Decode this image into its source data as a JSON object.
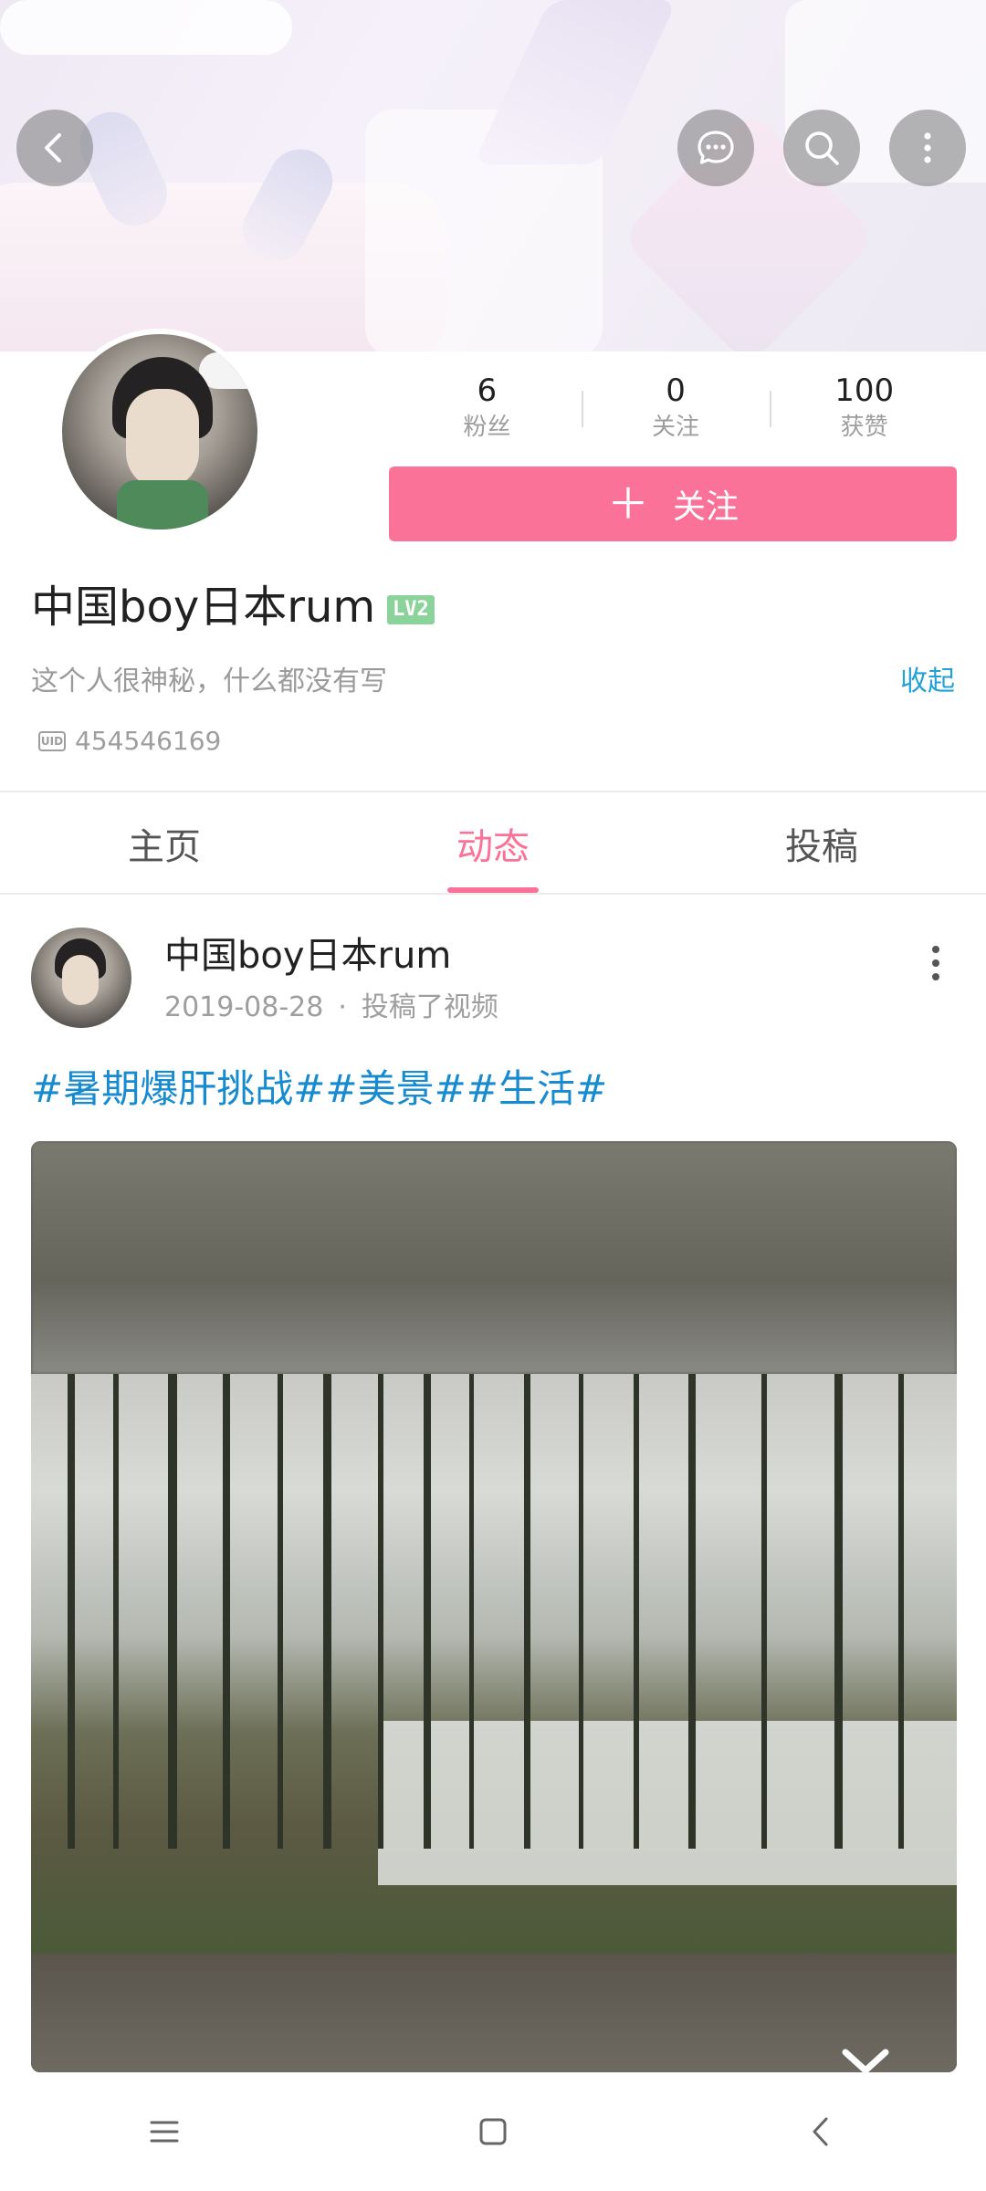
{
  "header": {
    "back_icon": "back-chevron-icon",
    "message_icon": "message-bubble-icon",
    "search_icon": "search-icon",
    "more_icon": "more-vertical-icon"
  },
  "profile": {
    "stats": [
      {
        "value": "6",
        "label": "粉丝"
      },
      {
        "value": "0",
        "label": "关注"
      },
      {
        "value": "100",
        "label": "获赞"
      }
    ],
    "follow_button": {
      "plus": "＋",
      "label": "关注"
    },
    "username": "中国boy日本rum",
    "level": "LV2",
    "bio": "这个人很神秘，什么都没有写",
    "collapse_label": "收起",
    "uid_icon_text": "UID",
    "uid": "454546169"
  },
  "tabs": [
    {
      "label": "主页",
      "active": false
    },
    {
      "label": "动态",
      "active": true
    },
    {
      "label": "投稿",
      "active": false
    }
  ],
  "post": {
    "author": "中国boy日本rum",
    "date": "2019-08-28",
    "separator": "·",
    "action": "投稿了视频",
    "hashtags": "#暑期爆肝挑战##美景##生活#"
  },
  "colors": {
    "accent_pink": "#fb7299",
    "link_blue": "#23a0d6",
    "hashtag_blue": "#178bcf",
    "level_green": "#8bd29b"
  },
  "navbar": {
    "menu_icon": "menu-icon",
    "home_icon": "home-square-icon",
    "back_icon": "nav-back-icon"
  }
}
